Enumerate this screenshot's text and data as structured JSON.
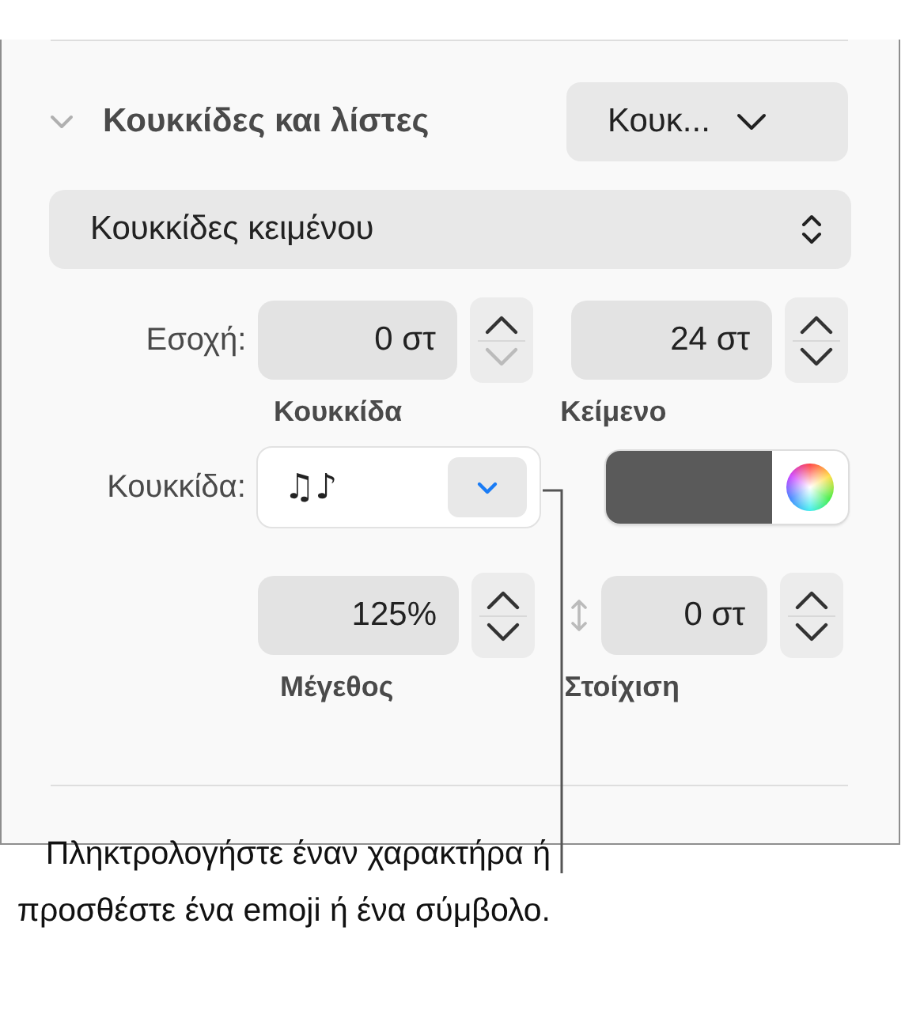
{
  "section": {
    "title": "Κουκκίδες και λίστες",
    "expanded": true,
    "style_menu": "Κουκ..."
  },
  "list_type": {
    "value": "Κουκκίδες κειμένου"
  },
  "indent": {
    "label": "Εσοχή:",
    "fields": [
      {
        "value": "0 στ",
        "caption": "Κουκκίδα",
        "up_disabled": false,
        "down_disabled": true
      },
      {
        "value": "24 στ",
        "caption": "Κείμενο",
        "up_disabled": false,
        "down_disabled": false
      }
    ]
  },
  "bullet": {
    "label": "Κουκκίδα:",
    "value": "♫♪",
    "color": "#5a5a5a"
  },
  "size_align": [
    {
      "kind": "size",
      "value": "125%",
      "caption": "Μέγεθος",
      "up_disabled": false,
      "down_disabled": false
    },
    {
      "kind": "align",
      "value": "0 στ",
      "caption": "Στοίχιση",
      "up_disabled": false,
      "down_disabled": false
    }
  ],
  "callout": "Πληκτρολογήστε έναν χαρακτήρα ή προσθέστε ένα emoji ή ένα σύμβολο."
}
